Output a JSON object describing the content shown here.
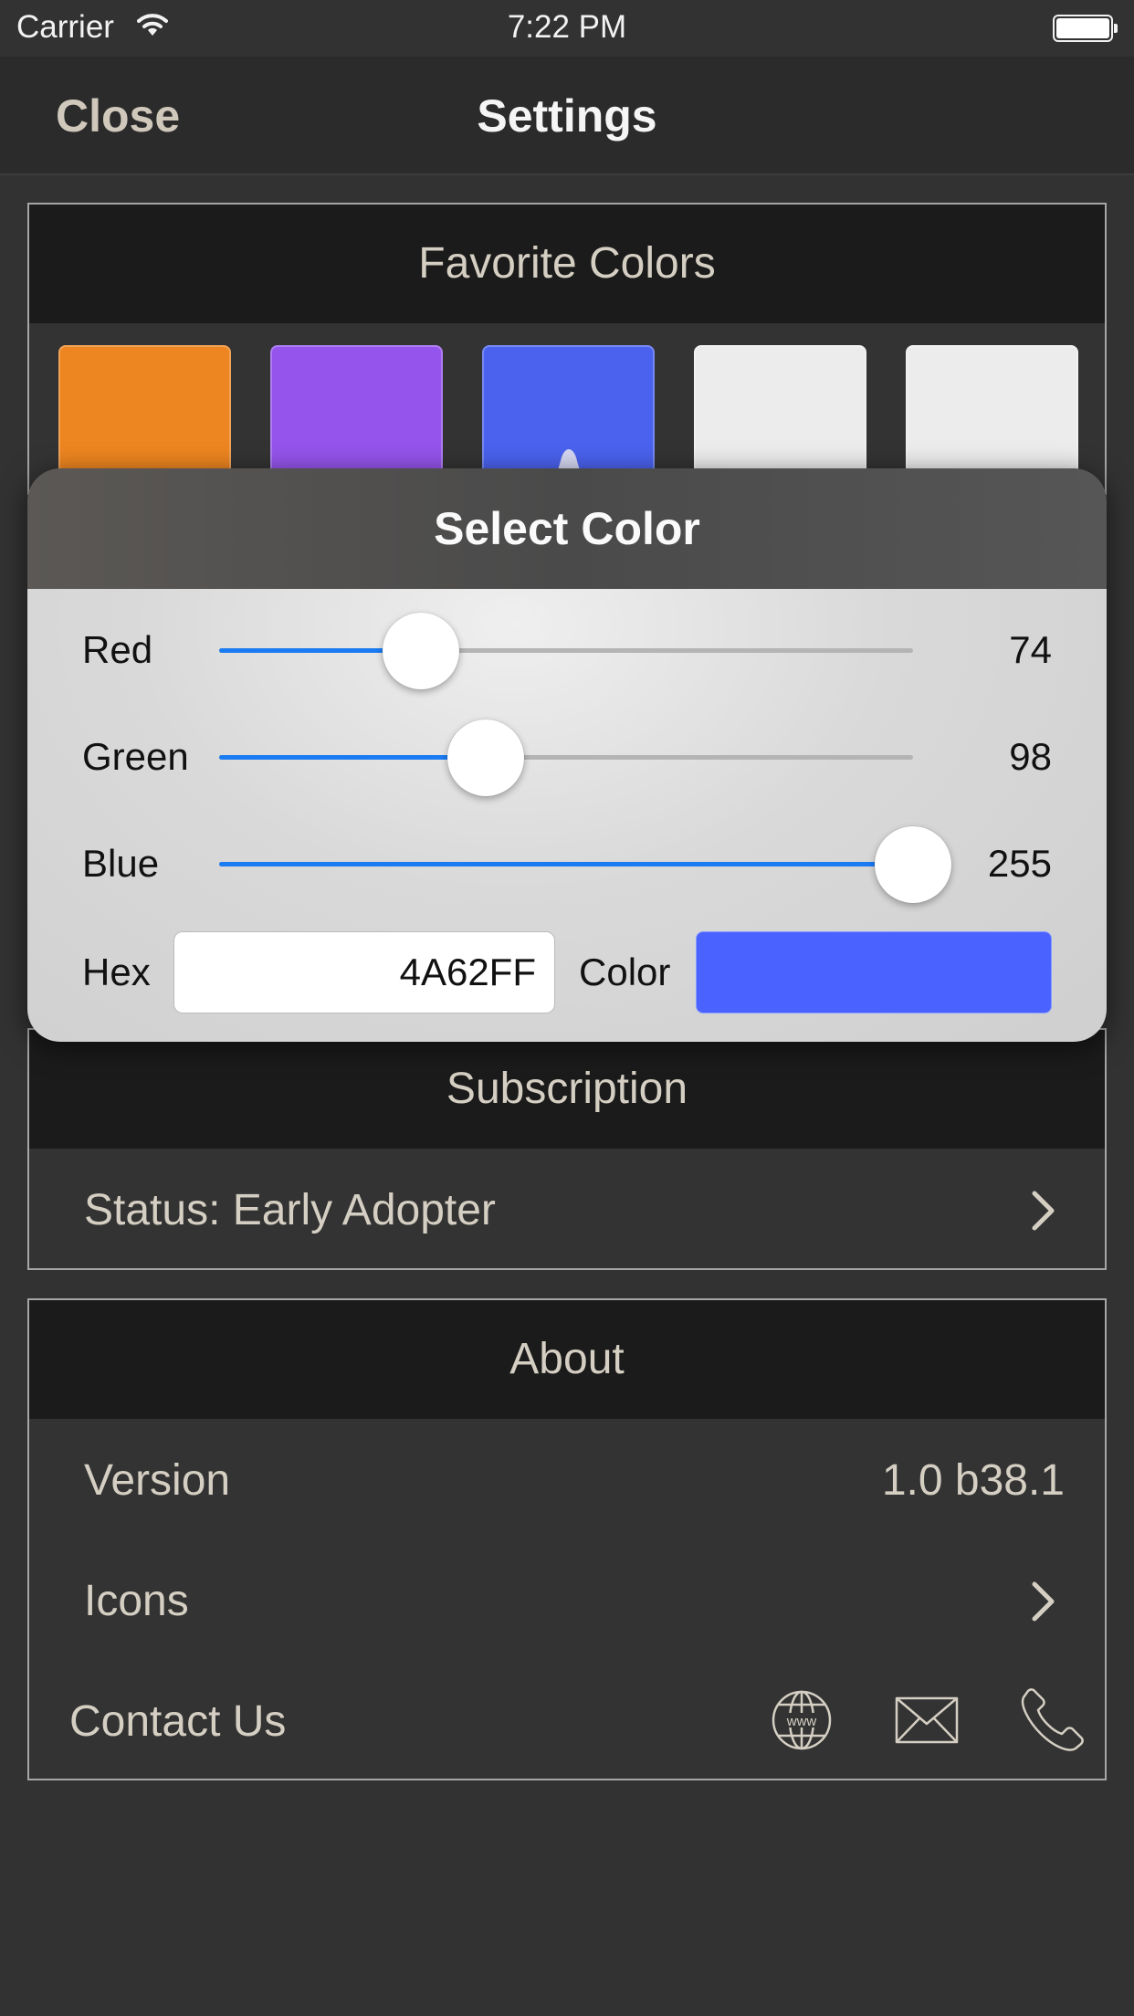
{
  "status_bar": {
    "carrier": "Carrier",
    "time": "7:22 PM"
  },
  "nav": {
    "close_label": "Close",
    "title": "Settings"
  },
  "favorite_colors": {
    "title": "Favorite Colors",
    "swatches": [
      "#ED8520",
      "#9554EC",
      "#4A62EE",
      "#ECECEC",
      "#ECECEC"
    ],
    "selected_index": 2
  },
  "picker": {
    "title": "Select Color",
    "sliders": [
      {
        "label": "Red",
        "value": "74",
        "max": 255
      },
      {
        "label": "Green",
        "value": "98",
        "max": 255
      },
      {
        "label": "Blue",
        "value": "255",
        "max": 255
      }
    ],
    "hex_label": "Hex",
    "hex_value": "4A62FF",
    "color_label": "Color",
    "preview_color": "#4A62FF",
    "accent_color": "#1A7BF2"
  },
  "subscription": {
    "title": "Subscription",
    "status_label": "Status: Early Adopter"
  },
  "about": {
    "title": "About",
    "version_label": "Version",
    "version_value": "1.0 b38.1",
    "icons_label": "Icons",
    "contact_label": "Contact Us",
    "contact_icons": [
      "globe-icon",
      "mail-icon",
      "phone-icon"
    ]
  }
}
